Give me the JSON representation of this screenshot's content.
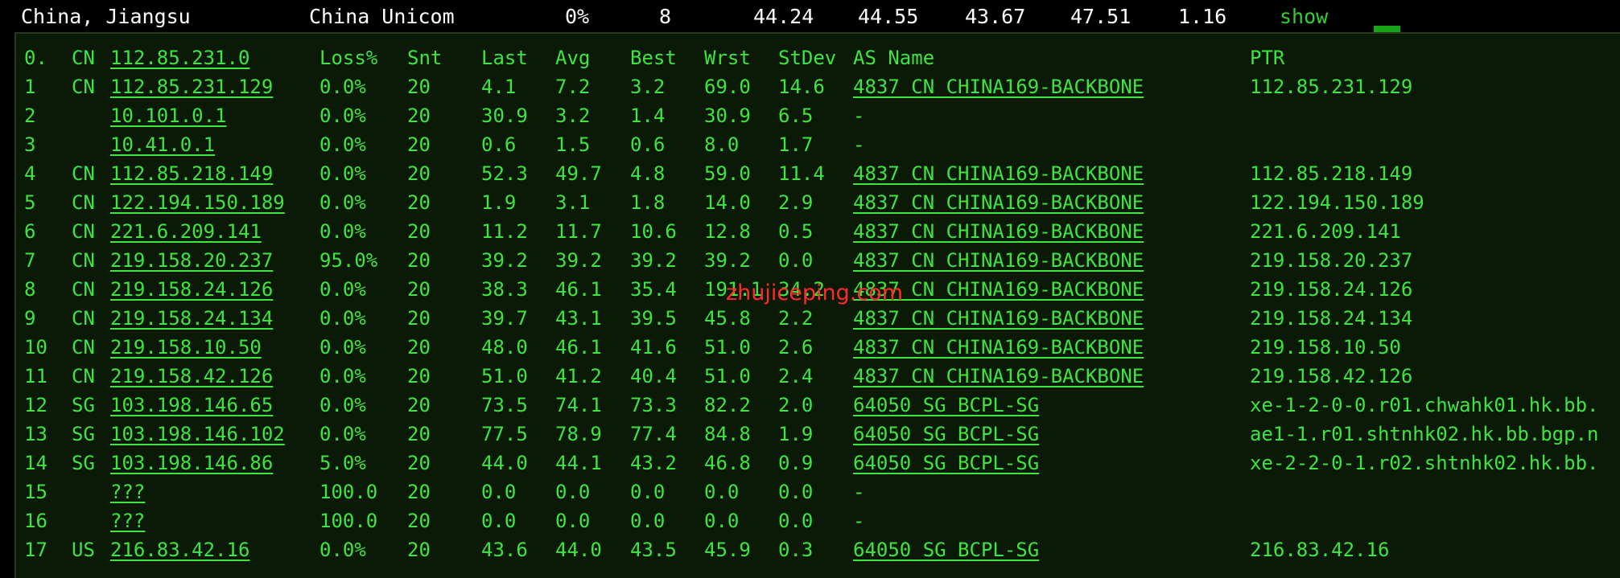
{
  "summary": {
    "location": "China, Jiangsu",
    "isp": "China Unicom",
    "loss": "0%",
    "sent": "8",
    "last": "44.24",
    "avg": "44.55",
    "best": "43.67",
    "worst": "47.51",
    "stdev": "1.16",
    "action": "show"
  },
  "table": {
    "header": {
      "num": "0.",
      "cc": "CN",
      "host": "112.85.231.0",
      "loss": "Loss%",
      "snt": "Snt",
      "last": "Last",
      "avg": "Avg",
      "best": "Best",
      "wrst": "Wrst",
      "stdev": "StDev",
      "as": "AS Name",
      "ptr": "PTR"
    },
    "rows": [
      {
        "num": "1",
        "cc": "CN",
        "host": "112.85.231.129",
        "loss": "0.0%",
        "snt": "20",
        "last": "4.1",
        "avg": "7.2",
        "best": "3.2",
        "wrst": "69.0",
        "stdev": "14.6",
        "as": "4837  CN CHINA169-BACKBONE",
        "ptr": "112.85.231.129"
      },
      {
        "num": "2",
        "cc": "",
        "host": "10.101.0.1",
        "loss": "0.0%",
        "snt": "20",
        "last": "30.9",
        "avg": "3.2",
        "best": "1.4",
        "wrst": "30.9",
        "stdev": "6.5",
        "as": "-",
        "ptr": ""
      },
      {
        "num": "3",
        "cc": "",
        "host": "10.41.0.1",
        "loss": "0.0%",
        "snt": "20",
        "last": "0.6",
        "avg": "1.5",
        "best": "0.6",
        "wrst": "8.0",
        "stdev": "1.7",
        "as": "-",
        "ptr": ""
      },
      {
        "num": "4",
        "cc": "CN",
        "host": "112.85.218.149",
        "loss": "0.0%",
        "snt": "20",
        "last": "52.3",
        "avg": "49.7",
        "best": "4.8",
        "wrst": "59.0",
        "stdev": "11.4",
        "as": "4837  CN CHINA169-BACKBONE",
        "ptr": "112.85.218.149"
      },
      {
        "num": "5",
        "cc": "CN",
        "host": "122.194.150.189",
        "loss": "0.0%",
        "snt": "20",
        "last": "1.9",
        "avg": "3.1",
        "best": "1.8",
        "wrst": "14.0",
        "stdev": "2.9",
        "as": "4837  CN CHINA169-BACKBONE",
        "ptr": "122.194.150.189"
      },
      {
        "num": "6",
        "cc": "CN",
        "host": "221.6.209.141",
        "loss": "0.0%",
        "snt": "20",
        "last": "11.2",
        "avg": "11.7",
        "best": "10.6",
        "wrst": "12.8",
        "stdev": "0.5",
        "as": "4837  CN CHINA169-BACKBONE",
        "ptr": "221.6.209.141"
      },
      {
        "num": "7",
        "cc": "CN",
        "host": "219.158.20.237",
        "loss": "95.0%",
        "snt": "20",
        "last": "39.2",
        "avg": "39.2",
        "best": "39.2",
        "wrst": "39.2",
        "stdev": "0.0",
        "as": "4837  CN CHINA169-BACKBONE",
        "ptr": "219.158.20.237"
      },
      {
        "num": "8",
        "cc": "CN",
        "host": "219.158.24.126",
        "loss": "0.0%",
        "snt": "20",
        "last": "38.3",
        "avg": "46.1",
        "best": "35.4",
        "wrst": "191.1",
        "stdev": "34.2",
        "as": "4837  CN CHINA169-BACKBONE",
        "ptr": "219.158.24.126"
      },
      {
        "num": "9",
        "cc": "CN",
        "host": "219.158.24.134",
        "loss": "0.0%",
        "snt": "20",
        "last": "39.7",
        "avg": "43.1",
        "best": "39.5",
        "wrst": "45.8",
        "stdev": "2.2",
        "as": "4837  CN CHINA169-BACKBONE",
        "ptr": "219.158.24.134"
      },
      {
        "num": "10",
        "cc": "CN",
        "host": "219.158.10.50",
        "loss": "0.0%",
        "snt": "20",
        "last": "48.0",
        "avg": "46.1",
        "best": "41.6",
        "wrst": "51.0",
        "stdev": "2.6",
        "as": "4837  CN CHINA169-BACKBONE",
        "ptr": "219.158.10.50"
      },
      {
        "num": "11",
        "cc": "CN",
        "host": "219.158.42.126",
        "loss": "0.0%",
        "snt": "20",
        "last": "51.0",
        "avg": "41.2",
        "best": "40.4",
        "wrst": "51.0",
        "stdev": "2.4",
        "as": "4837  CN CHINA169-BACKBONE",
        "ptr": "219.158.42.126"
      },
      {
        "num": "12",
        "cc": "SG",
        "host": "103.198.146.65",
        "loss": "0.0%",
        "snt": "20",
        "last": "73.5",
        "avg": "74.1",
        "best": "73.3",
        "wrst": "82.2",
        "stdev": "2.0",
        "as": "64050 SG BCPL-SG",
        "ptr": "xe-1-2-0-0.r01.chwahk01.hk.bb."
      },
      {
        "num": "13",
        "cc": "SG",
        "host": "103.198.146.102",
        "loss": "0.0%",
        "snt": "20",
        "last": "77.5",
        "avg": "78.9",
        "best": "77.4",
        "wrst": "84.8",
        "stdev": "1.9",
        "as": "64050 SG BCPL-SG",
        "ptr": "ae1-1.r01.shtnhk02.hk.bb.bgp.n"
      },
      {
        "num": "14",
        "cc": "SG",
        "host": "103.198.146.86",
        "loss": "5.0%",
        "snt": "20",
        "last": "44.0",
        "avg": "44.1",
        "best": "43.2",
        "wrst": "46.8",
        "stdev": "0.9",
        "as": "64050 SG BCPL-SG",
        "ptr": "xe-2-2-0-1.r02.shtnhk02.hk.bb."
      },
      {
        "num": "15",
        "cc": "",
        "host": "???",
        "loss": "100.0",
        "snt": "20",
        "last": "0.0",
        "avg": "0.0",
        "best": "0.0",
        "wrst": "0.0",
        "stdev": "0.0",
        "as": "-",
        "ptr": ""
      },
      {
        "num": "16",
        "cc": "",
        "host": "???",
        "loss": "100.0",
        "snt": "20",
        "last": "0.0",
        "avg": "0.0",
        "best": "0.0",
        "wrst": "0.0",
        "stdev": "0.0",
        "as": "-",
        "ptr": ""
      },
      {
        "num": "17",
        "cc": "US",
        "host": "216.83.42.16",
        "loss": "0.0%",
        "snt": "20",
        "last": "43.6",
        "avg": "44.0",
        "best": "43.5",
        "wrst": "45.9",
        "stdev": "0.3",
        "as": "64050 SG BCPL-SG",
        "ptr": "216.83.42.16"
      }
    ]
  },
  "watermark": "zhujiceping.com",
  "colors": {
    "text_green": "#3fe43f",
    "panel_bg": "#0b1a06",
    "watermark": "#ff2a2a"
  }
}
